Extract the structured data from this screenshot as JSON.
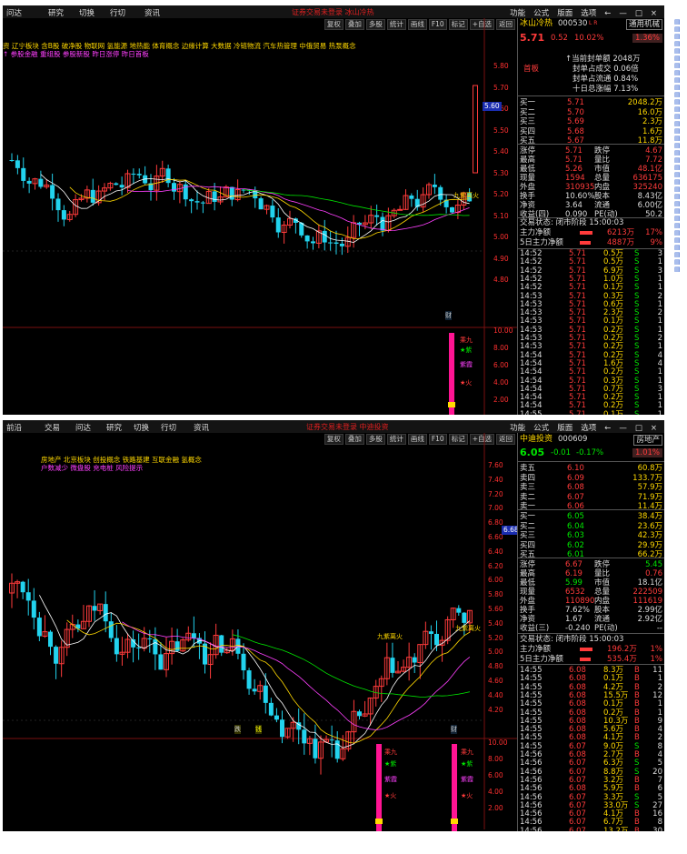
{
  "colors": {
    "up": "#ff3b3b",
    "down": "#00e600",
    "cyan": "#22d3ee",
    "yellow": "#ffd800",
    "magenta": "#ff40ff"
  },
  "menu_items_1": [
    "问达",
    "研究",
    "切换",
    "行切",
    "资讯"
  ],
  "menu_items_2": [
    "前沿",
    "交易",
    "问达",
    "研究",
    "切换",
    "行切",
    "资讯"
  ],
  "alert_title_1": "证券交易未登录  冰山冷热",
  "alert_title_2": "证券交易未登录  中迪投资",
  "right_menu": [
    "功能",
    "公式",
    "版面",
    "选项",
    "←",
    "—",
    "□",
    "×"
  ],
  "toolbar": [
    "复权",
    "叠加",
    "多股",
    "统计",
    "画线",
    "F10",
    "标记",
    "+自选",
    "返回"
  ],
  "p1": {
    "concepts": "资 辽宁板块 含B股 破净股 物联网 氢能源 地热能 体育概念 边缘计算 大数据 冷链物流 汽车热管理 中俄贸易 热泵概念",
    "concepts2": "↑ 参股金融 重组股 参股新股 昨日涨停 昨日首板",
    "yaxis": [
      "5.80",
      "5.70",
      "5.60",
      "5.50",
      "5.40",
      "5.30",
      "5.20",
      "5.10",
      "5.00",
      "4.90",
      "4.80"
    ],
    "price_tag": "5.60",
    "sub_axis": [
      "10.00",
      "8.00",
      "6.00",
      "4.00",
      "2.00"
    ],
    "annot_nine": "九紫离火",
    "ind_labels": [
      "乘九",
      "★紫",
      "紫霞",
      "★火"
    ],
    "marker": "财",
    "stock": {
      "name": "冰山冷热",
      "code": "000530",
      "tag": "L R",
      "industry": "通用机械",
      "price": "5.71",
      "change": "0.52",
      "pct": "10.02%",
      "right_pct": "1.36%"
    },
    "seal": {
      "badge": "首板",
      "l1": "↑当前封单额 2048万",
      "l2": "封单占成交 0.06倍",
      "l3": "封单占流通 0.84%",
      "l4": "十日总涨幅 7.13%"
    },
    "book": [
      [
        "买一",
        "5.71",
        "2048.2万"
      ],
      [
        "买二",
        "5.70",
        "16.0万"
      ],
      [
        "买三",
        "5.69",
        "2.3万"
      ],
      [
        "买四",
        "5.68",
        "1.6万"
      ],
      [
        "买五",
        "5.67",
        "11.8万"
      ]
    ],
    "stats": [
      [
        "涨停",
        "5.71",
        "跌停",
        "4.67"
      ],
      [
        "最高",
        "5.71",
        "量比",
        "7.72"
      ],
      [
        "最低",
        "5.26",
        "市值",
        "48.1亿"
      ],
      [
        "现量",
        "1594",
        "总量",
        "636175"
      ],
      [
        "外盘",
        "310935",
        "内盘",
        "325240"
      ],
      [
        "换手",
        "10.60%",
        "股本",
        "8.43亿"
      ],
      [
        "净资",
        "3.64",
        "流通",
        "6.00亿"
      ],
      [
        "收益(四)",
        "0.090",
        "PE(动)",
        "50.2"
      ]
    ],
    "status": "交易状态: 闭市阶段 15:00:03",
    "flow": [
      [
        "主力净额",
        "6213万",
        "17%"
      ],
      [
        "5日主力净额",
        "4887万",
        "9%"
      ]
    ],
    "ticks": [
      [
        "14:52",
        "5.71",
        "0.5万",
        "S",
        "3"
      ],
      [
        "14:52",
        "5.71",
        "0.5万",
        "S",
        "1"
      ],
      [
        "14:52",
        "5.71",
        "6.9万",
        "S",
        "3"
      ],
      [
        "14:52",
        "5.71",
        "1.0万",
        "S",
        "1"
      ],
      [
        "14:52",
        "5.71",
        "0.1万",
        "S",
        "1"
      ],
      [
        "14:53",
        "5.71",
        "0.3万",
        "S",
        "2"
      ],
      [
        "14:53",
        "5.71",
        "0.6万",
        "S",
        "1"
      ],
      [
        "14:53",
        "5.71",
        "2.3万",
        "S",
        "2"
      ],
      [
        "14:53",
        "5.71",
        "0.1万",
        "S",
        "1"
      ],
      [
        "14:53",
        "5.71",
        "0.2万",
        "S",
        "1"
      ],
      [
        "14:53",
        "5.71",
        "0.2万",
        "S",
        "2"
      ],
      [
        "14:53",
        "5.71",
        "0.2万",
        "S",
        "1"
      ],
      [
        "14:54",
        "5.71",
        "0.2万",
        "S",
        "4"
      ],
      [
        "14:54",
        "5.71",
        "1.6万",
        "S",
        "4"
      ],
      [
        "14:54",
        "5.71",
        "0.2万",
        "S",
        "1"
      ],
      [
        "14:54",
        "5.71",
        "0.3万",
        "S",
        "1"
      ],
      [
        "14:54",
        "5.71",
        "0.7万",
        "S",
        "3"
      ],
      [
        "14:54",
        "5.71",
        "0.2万",
        "S",
        "1"
      ],
      [
        "14:54",
        "5.71",
        "0.2万",
        "S",
        "1"
      ],
      [
        "14:55",
        "5.71",
        "0.1万",
        "S",
        "1"
      ]
    ]
  },
  "p2": {
    "concepts": "房地产     北京板块     创投概念 铁路基建 互联金融 氢概念",
    "concepts2": "户数减少 微盘股 充电桩 风险提示",
    "yaxis": [
      "7.60",
      "7.40",
      "7.20",
      "7.00",
      "6.80",
      "6.60",
      "6.40",
      "6.20",
      "6.00",
      "5.80",
      "5.60",
      "5.40",
      "5.20",
      "5.00",
      "4.80",
      "4.60",
      "4.40",
      "4.20"
    ],
    "price_tag": "6.68",
    "sub_axis": [
      "10.00",
      "8.00",
      "6.00",
      "4.00",
      "2.00"
    ],
    "annot_nine_a": "九紫离火",
    "annot_nine_b": "九紫离火",
    "ind_labels": [
      "乘九",
      "★紫",
      "紫霞",
      "★火"
    ],
    "markers": [
      "跌",
      "钱",
      "财"
    ],
    "stock": {
      "name": "中迪投资",
      "code": "000609",
      "industry": "房地产",
      "price": "6.05",
      "change": "-0.01",
      "pct": "-0.17%",
      "right_pct": "1.01%"
    },
    "book_sell": [
      [
        "卖五",
        "6.10",
        "60.8万"
      ],
      [
        "卖四",
        "6.09",
        "133.7万"
      ],
      [
        "卖三",
        "6.08",
        "57.9万"
      ],
      [
        "卖二",
        "6.07",
        "71.9万"
      ],
      [
        "卖一",
        "6.06",
        "11.4万"
      ]
    ],
    "book_buy": [
      [
        "买一",
        "6.05",
        "38.4万"
      ],
      [
        "买二",
        "6.04",
        "23.6万"
      ],
      [
        "买三",
        "6.03",
        "42.3万"
      ],
      [
        "买四",
        "6.02",
        "29.9万"
      ],
      [
        "买五",
        "6.01",
        "66.2万"
      ]
    ],
    "stats": [
      [
        "涨停",
        "6.67",
        "跌停",
        "5.45"
      ],
      [
        "最高",
        "6.19",
        "量比",
        "0.76"
      ],
      [
        "最低",
        "5.99",
        "市值",
        "18.1亿"
      ],
      [
        "现量",
        "6532",
        "总量",
        "222509"
      ],
      [
        "外盘",
        "110890",
        "内盘",
        "111619"
      ],
      [
        "换手",
        "7.62%",
        "股本",
        "2.99亿"
      ],
      [
        "净资",
        "1.67",
        "流通",
        "2.92亿"
      ],
      [
        "收益(三)",
        "-0.240",
        "PE(动)",
        "--"
      ]
    ],
    "status": "交易状态: 闭市阶段 15:00:03",
    "flow": [
      [
        "主力净额",
        "196.2万",
        "1%"
      ],
      [
        "5日主力净额",
        "535.4万",
        "1%"
      ]
    ],
    "ticks": [
      [
        "14:55",
        "6.08",
        "8.3万",
        "B",
        "11"
      ],
      [
        "14:55",
        "6.08",
        "0.1万",
        "B",
        "1"
      ],
      [
        "14:55",
        "6.08",
        "4.2万",
        "B",
        "2"
      ],
      [
        "14:55",
        "6.08",
        "15.5万",
        "B",
        "12"
      ],
      [
        "14:55",
        "6.08",
        "0.1万",
        "B",
        "1"
      ],
      [
        "14:55",
        "6.08",
        "0.2万",
        "B",
        "1"
      ],
      [
        "14:55",
        "6.08",
        "10.3万",
        "B",
        "9"
      ],
      [
        "14:55",
        "6.08",
        "5.6万",
        "B",
        "4"
      ],
      [
        "14:55",
        "6.08",
        "4.1万",
        "B",
        "2"
      ],
      [
        "14:55",
        "6.07",
        "9.0万",
        "S",
        "8"
      ],
      [
        "14:56",
        "6.08",
        "2.7万",
        "B",
        "4"
      ],
      [
        "14:56",
        "6.07",
        "6.3万",
        "S",
        "5"
      ],
      [
        "14:56",
        "6.07",
        "8.8万",
        "S",
        "20"
      ],
      [
        "14:56",
        "6.07",
        "3.2万",
        "B",
        "7"
      ],
      [
        "14:56",
        "6.08",
        "5.9万",
        "B",
        "6"
      ],
      [
        "14:56",
        "6.07",
        "3.3万",
        "S",
        "5"
      ],
      [
        "14:56",
        "6.07",
        "33.0万",
        "S",
        "27"
      ],
      [
        "14:56",
        "6.07",
        "4.1万",
        "B",
        "16"
      ],
      [
        "14:56",
        "6.07",
        "6.7万",
        "B",
        "8"
      ],
      [
        "14:56",
        "6.07",
        "13.2万",
        "B",
        "30"
      ]
    ]
  }
}
